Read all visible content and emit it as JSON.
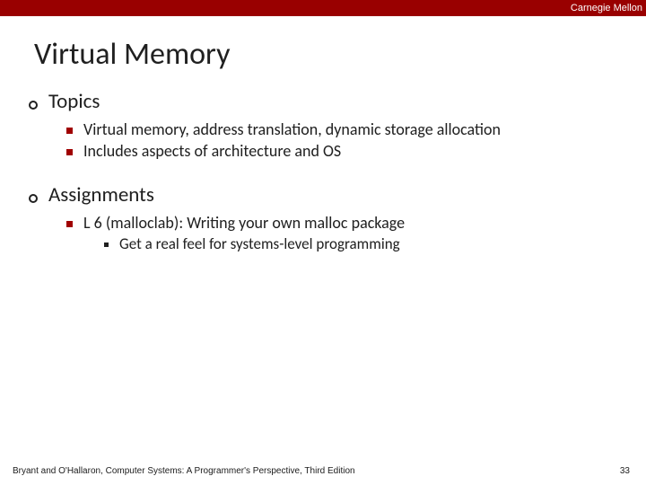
{
  "header": {
    "institution": "Carnegie Mellon"
  },
  "title": "Virtual Memory",
  "sections": [
    {
      "heading": "Topics",
      "items": [
        {
          "text": "Virtual memory, address translation, dynamic storage allocation"
        },
        {
          "text": "Includes aspects of architecture and OS"
        }
      ]
    },
    {
      "heading": "Assignments",
      "items": [
        {
          "text": "L 6 (malloclab): Writing your own malloc package",
          "subitems": [
            {
              "text": "Get a real feel for systems-level programming"
            }
          ]
        }
      ]
    }
  ],
  "footer": {
    "attribution": "Bryant and O'Hallaron, Computer Systems: A Programmer's Perspective, Third Edition",
    "page_number": "33"
  }
}
